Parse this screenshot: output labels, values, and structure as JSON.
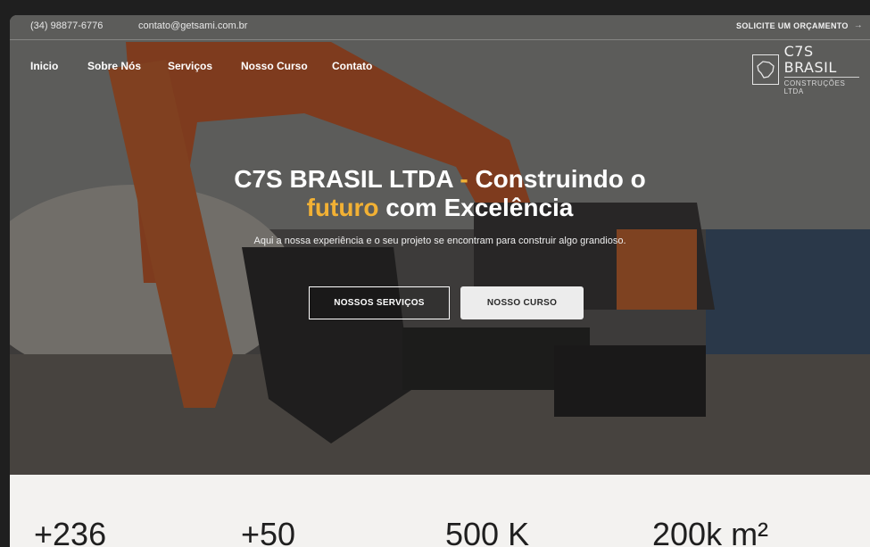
{
  "topbar": {
    "phone": "(34) 98877-6776",
    "email": "contato@getsami.com.br",
    "quote_label": "SOLICITE UM ORÇAMENTO",
    "quote_arrow": "→"
  },
  "nav": {
    "items": [
      "Inicio",
      "Sobre Nós",
      "Serviços",
      "Nosso Curso",
      "Contato"
    ]
  },
  "logo": {
    "name": "C7S BRASIL",
    "subtitle": "CONSTRUÇÕES LTDA"
  },
  "hero": {
    "title_part1": "C7S BRASIL LTDA",
    "title_dash": " - ",
    "title_part2": "Construindo o",
    "title_accent": "futuro",
    "title_part3": " com Excelência",
    "subtitle": "Aqui a nossa experiência e o seu projeto se encontram para construir algo grandioso.",
    "btn_services": "NOSSOS SERVIÇOS",
    "btn_course": "NOSSO CURSO",
    "accent_color": "#f2b134"
  },
  "stats": {
    "values": [
      "+236",
      "+50",
      "500 K",
      "200k m²"
    ]
  }
}
